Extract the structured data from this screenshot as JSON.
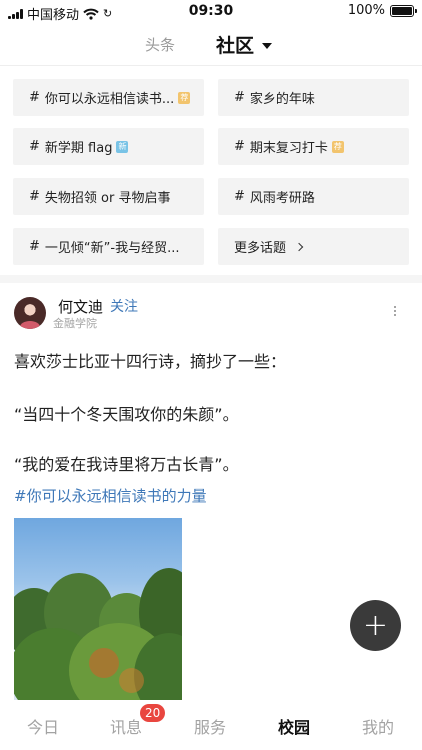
{
  "status_bar": {
    "carrier": "中国移动",
    "time": "09:30",
    "battery": "100%"
  },
  "top_nav": {
    "tab_news": "头条",
    "tab_community": "社区"
  },
  "topics": [
    {
      "label": "你可以永远相信读书...",
      "badge": "荐"
    },
    {
      "label": "家乡的年味",
      "badge": ""
    },
    {
      "label": "新学期 flag",
      "badge": "新"
    },
    {
      "label": "期末复习打卡",
      "badge": "荐"
    },
    {
      "label": "失物招领 or 寻物启事",
      "badge": ""
    },
    {
      "label": "风雨考研路",
      "badge": ""
    },
    {
      "label": "一见倾“新”-我与经贸...",
      "badge": ""
    }
  ],
  "topics_more": "更多话题",
  "post": {
    "author": "何文迪",
    "follow": "关注",
    "college": "金融学院",
    "lines": [
      "喜欢莎士比亚十四行诗，摘抄了一些：",
      "“当四十个冬天围攻你的朱颜”。",
      "“我的爱在我诗里将万古长青”。"
    ],
    "topic_tag": "#你可以永远相信读书的力量"
  },
  "fab": "+",
  "bottom_nav": {
    "items": [
      "今日",
      "讯息",
      "服务",
      "校园",
      "我的"
    ],
    "active": "校园",
    "message_badge": "20"
  },
  "colors": {
    "accent_blue": "#3f78b8",
    "badge_red": "#e9463f",
    "hot_badge": "#f2c46d",
    "new_badge": "#79c3e6"
  }
}
